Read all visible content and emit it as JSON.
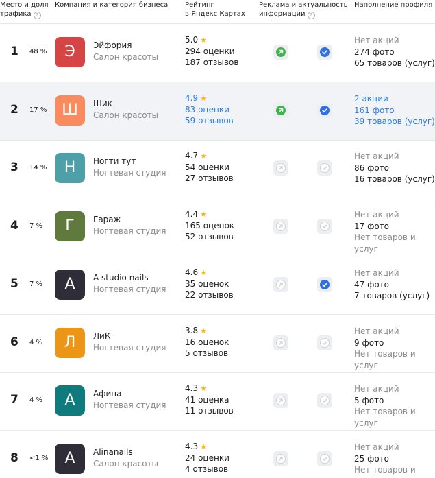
{
  "columns": {
    "place_line1": "Место и доля",
    "place_line2": "трафика",
    "company": "Компания и категория бизнеса",
    "rating_line1": "Рейтинг",
    "rating_line2": "в Яндекс Картах",
    "ads_line1": "Реклама и актуальность",
    "ads_line2": "информации",
    "profile": "Наполнение профиля"
  },
  "icons": {
    "hint": "?",
    "star": "★",
    "ads": "promo-arrow-icon",
    "actual": "check-circle-icon"
  },
  "colors": {
    "green": "#3bb54a",
    "blue": "#2f6fe4",
    "link": "#2b7de0",
    "star": "#fcb900"
  },
  "rows": [
    {
      "place": "1",
      "share": "48 %",
      "letter": "Э",
      "color": "#d64545",
      "name": "Эйфория",
      "category": "Салон красоты",
      "rating": "5.0",
      "ratings_count": "294 оценки",
      "reviews": "187 отзывов",
      "ads_active": true,
      "info_actual": true,
      "promos": "Нет акций",
      "photos": "274 фото",
      "goods": "65 товаров (услуг)"
    },
    {
      "place": "2",
      "share": "17 %",
      "letter": "Ш",
      "color": "#f98b5e",
      "name": "Шик",
      "category": "Салон красоты",
      "rating": "4.9",
      "ratings_count": "83 оценки",
      "reviews": "59 отзывов",
      "ads_active": true,
      "info_actual": true,
      "promos": "2 акции",
      "photos": "161 фото",
      "goods": "39 товаров (услуг)"
    },
    {
      "place": "3",
      "share": "14 %",
      "letter": "Н",
      "color": "#4d9fa8",
      "name": "Ногти тут",
      "category": "Ногтевая студия",
      "rating": "4.7",
      "ratings_count": "54 оценки",
      "reviews": "27 отзывов",
      "ads_active": false,
      "info_actual": false,
      "promos": "Нет акций",
      "photos": "86 фото",
      "goods": "16 товаров (услуг)"
    },
    {
      "place": "4",
      "share": "7 %",
      "letter": "Г",
      "color": "#5f7a3c",
      "name": "Гараж",
      "category": "Ногтевая студия",
      "rating": "4.4",
      "ratings_count": "165 оценок",
      "reviews": "52 отзывов",
      "ads_active": false,
      "info_actual": false,
      "promos": "Нет акций",
      "photos": "17 фото",
      "goods": "Нет товаров и услуг"
    },
    {
      "place": "5",
      "share": "7 %",
      "letter": "A",
      "color": "#2f2e38",
      "name": "A studio nails",
      "category": "Ногтевая студия",
      "rating": "4.6",
      "ratings_count": "35 оценок",
      "reviews": "22 отзывов",
      "ads_active": false,
      "info_actual": true,
      "promos": "Нет акций",
      "photos": "47 фото",
      "goods": "7 товаров (услуг)"
    },
    {
      "place": "6",
      "share": "4 %",
      "letter": "Л",
      "color": "#ec9618",
      "name": "ЛиК",
      "category": "Ногтевая студия",
      "rating": "3.8",
      "ratings_count": "16 оценок",
      "reviews": "5 отзывов",
      "ads_active": false,
      "info_actual": false,
      "promos": "Нет акций",
      "photos": "9 фото",
      "goods": "Нет товаров и услуг"
    },
    {
      "place": "7",
      "share": "4 %",
      "letter": "А",
      "color": "#0f7b7c",
      "name": "Афина",
      "category": "Ногтевая студия",
      "rating": "4.3",
      "ratings_count": "41 оценка",
      "reviews": "11 отзывов",
      "ads_active": false,
      "info_actual": false,
      "promos": "Нет акций",
      "photos": "5 фото",
      "goods": "Нет товаров и услуг"
    },
    {
      "place": "8",
      "share": "<1 %",
      "letter": "A",
      "color": "#2f2e38",
      "name": "Alinanails",
      "category": "Салон красоты",
      "rating": "4.3",
      "ratings_count": "24 оценки",
      "reviews": "4 отзывов",
      "ads_active": false,
      "info_actual": false,
      "promos": "Нет акций",
      "photos": "25 фото",
      "goods": "Нет товаров и услуг"
    }
  ]
}
